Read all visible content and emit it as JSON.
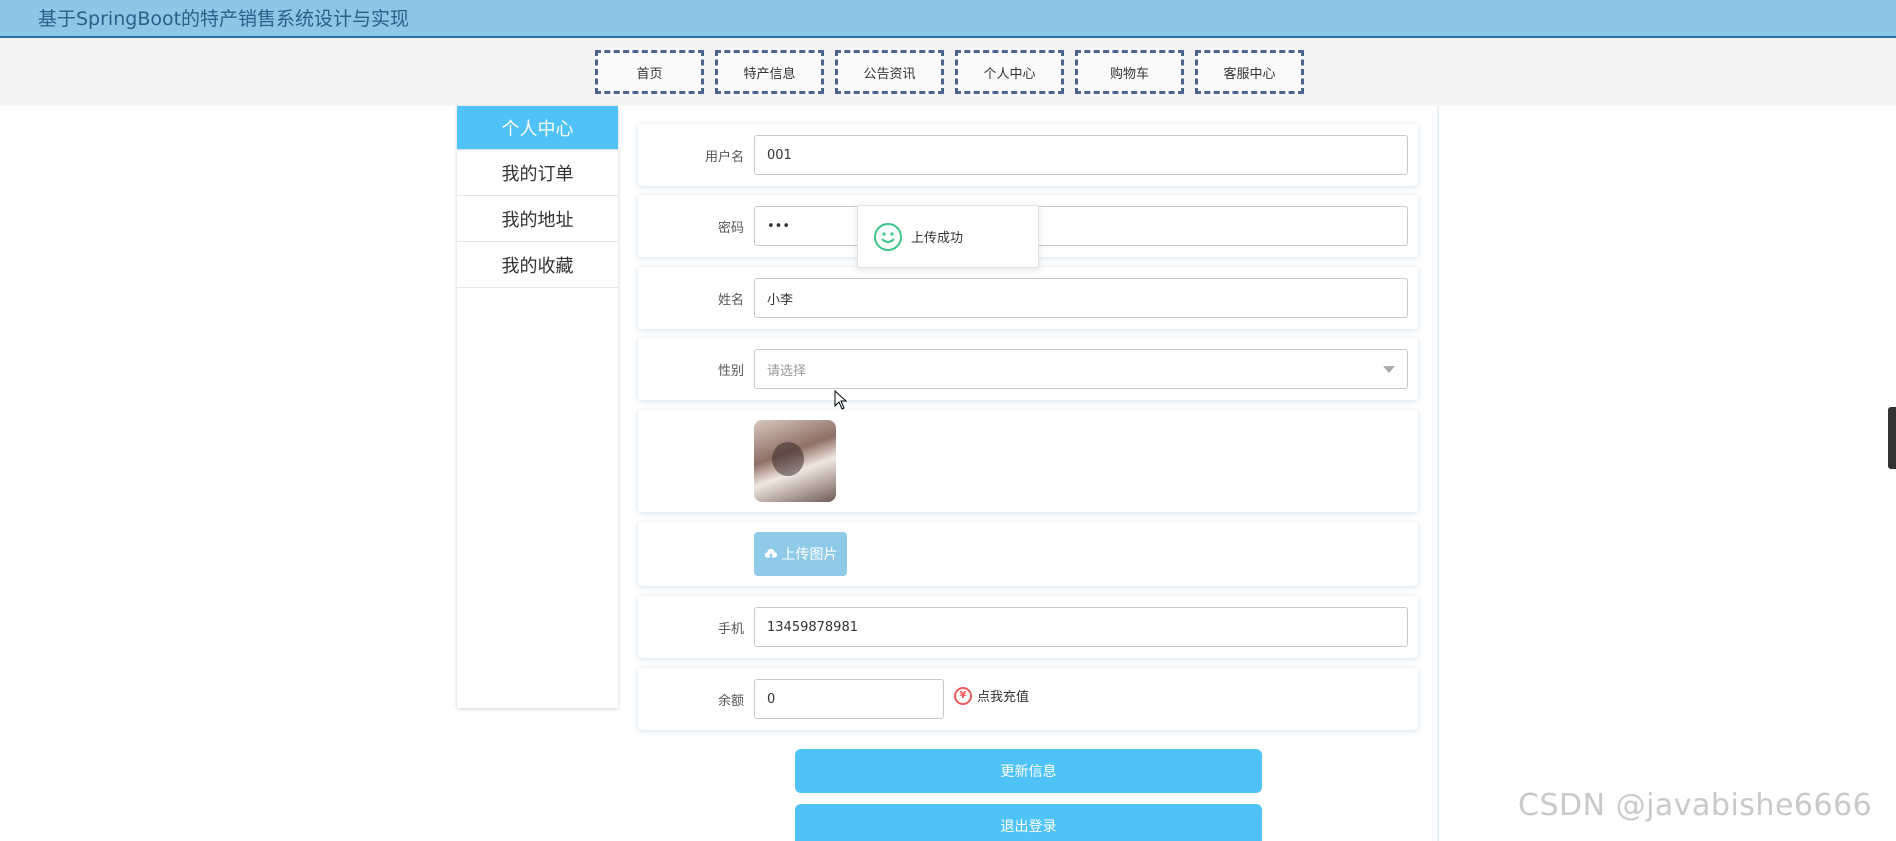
{
  "header": {
    "title": "基于SpringBoot的特产销售系统设计与实现"
  },
  "nav": {
    "items": [
      {
        "label": "首页"
      },
      {
        "label": "特产信息"
      },
      {
        "label": "公告资讯"
      },
      {
        "label": "个人中心"
      },
      {
        "label": "购物车"
      },
      {
        "label": "客服中心"
      }
    ]
  },
  "sidebar": {
    "items": [
      {
        "label": "个人中心"
      },
      {
        "label": "我的订单"
      },
      {
        "label": "我的地址"
      },
      {
        "label": "我的收藏"
      }
    ]
  },
  "form": {
    "username": {
      "label": "用户名",
      "value": "001"
    },
    "password": {
      "label": "密码",
      "value": "•••"
    },
    "name": {
      "label": "姓名",
      "value": "小李"
    },
    "gender": {
      "label": "性别",
      "placeholder": "请选择"
    },
    "upload": {
      "label": "上传图片"
    },
    "phone": {
      "label": "手机",
      "value": "13459878981"
    },
    "balance": {
      "label": "余额",
      "value": "0",
      "recharge": "点我充值"
    }
  },
  "buttons": {
    "update": "更新信息",
    "logout": "退出登录"
  },
  "toast": {
    "message": "上传成功"
  },
  "watermark": "CSDN @javabishe6666",
  "colors": {
    "header_bg": "#8cc7e6",
    "accent": "#4fc3f7",
    "upload": "#8fcbe8",
    "nav_border": "#4a6690"
  }
}
